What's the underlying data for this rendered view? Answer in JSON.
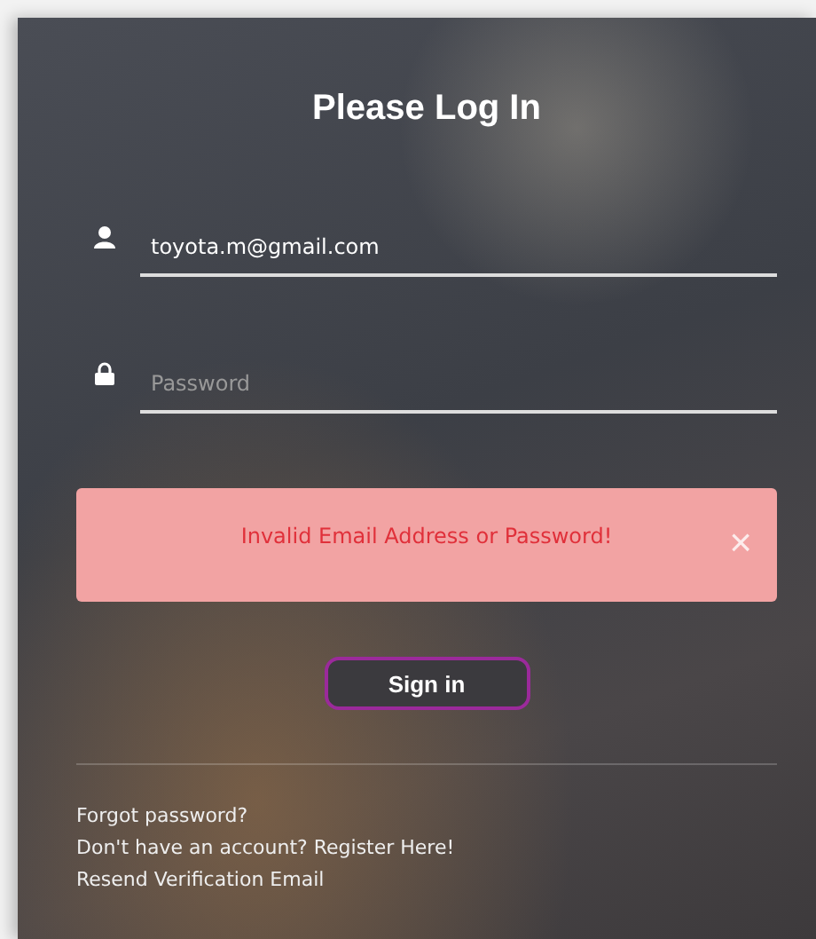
{
  "title": "Please Log In",
  "fields": [
    {
      "kind": "user",
      "value": "toyota.m@gmail.com"
    },
    {
      "kind": "password",
      "placeholder": "Password"
    }
  ],
  "alert": {
    "message": "Invalid Email Address or Password!",
    "close": "×"
  },
  "sign_in": {
    "label": "Sign in",
    "focused": true
  },
  "links": [
    "Forgot password?",
    "Don't have an account? Register Here!",
    "Resend Verification Email"
  ]
}
